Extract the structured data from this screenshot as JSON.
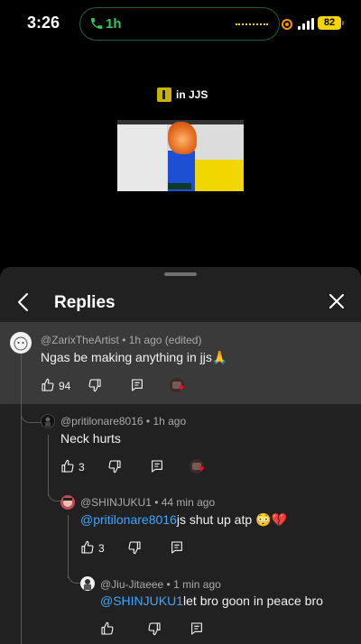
{
  "status_bar": {
    "time": "3:26",
    "call_duration": "1h",
    "battery": "82"
  },
  "video": {
    "title": "in JJS"
  },
  "sheet": {
    "title": "Replies"
  },
  "comments": [
    {
      "author": "@ZarixTheArtist",
      "time": "1h ago (edited)",
      "text": "Ngas be making anything in jjs🙏",
      "likes": "94",
      "creator_heart": true
    },
    {
      "author": "@pritilonare8016",
      "time": "1h ago",
      "text": "Neck hurts",
      "likes": "3",
      "creator_heart": true
    },
    {
      "author": "@SHINJUKU1",
      "time": "44 min ago",
      "mention": "@pritilonare8016",
      "text": "js shut up atp 😳💔",
      "likes": "3",
      "creator_heart": false
    },
    {
      "author": "@Jiu-Jitaeee",
      "time": "1 min ago",
      "mention": "@SHINJUKU1",
      "text": "let bro goon in peace bro",
      "likes": "",
      "creator_heart": false
    }
  ],
  "separator": " • ",
  "colors": {
    "accent_call": "#34c759",
    "battery": "#f5d400",
    "mention": "#3ea6ff",
    "sheet_bg": "#212121",
    "highlight_bg": "#3a3a3a"
  },
  "icons": [
    "phone-icon",
    "signal-icon",
    "battery-icon",
    "back-icon",
    "close-icon",
    "like-icon",
    "dislike-icon",
    "reply-icon",
    "heart-icon"
  ]
}
